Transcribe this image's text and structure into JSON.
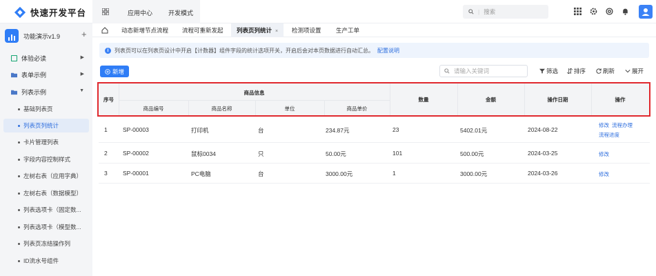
{
  "header": {
    "logo_text": "快速开发平台",
    "menus": [
      "应用中心",
      "开发模式"
    ],
    "search_placeholder": "搜索"
  },
  "sidebar": {
    "app_name": "功能演示v1.9",
    "groups": [
      {
        "label": "体验必读"
      },
      {
        "label": "表单示例"
      },
      {
        "label": "列表示例"
      }
    ],
    "sub_items": [
      {
        "label": "基础列表页"
      },
      {
        "label": "列表页列统计"
      },
      {
        "label": "卡片管理列表"
      },
      {
        "label": "字段内容控制样式"
      },
      {
        "label": "左树右表（应用字典）"
      },
      {
        "label": "左树右表（数据模型）"
      },
      {
        "label": "列表选项卡（固定数..."
      },
      {
        "label": "列表选项卡（模型数..."
      },
      {
        "label": "列表页冻结操作列"
      },
      {
        "label": "ID流水号组件"
      }
    ]
  },
  "tabs": [
    {
      "label": "动态新增节点流程"
    },
    {
      "label": "流程可重新发起"
    },
    {
      "label": "列表页列统计",
      "close": "×"
    },
    {
      "label": "检测项设置"
    },
    {
      "label": "生产工单"
    }
  ],
  "notice": {
    "text": "列表页可以在列表页设计中开启【计数器】组件字段的统计选项开关，开启后会对本页数据进行自动汇总。",
    "link": "配置说明"
  },
  "toolbar": {
    "add": "新增",
    "keyword_placeholder": "请输入关键词",
    "filter": "筛选",
    "sort": "排序",
    "refresh": "刷新",
    "expand": "展开"
  },
  "table": {
    "headers": {
      "seq": "序号",
      "group": "商品信息",
      "code": "商品编号",
      "name": "商品名称",
      "unit": "单位",
      "price": "商品单价",
      "qty": "数量",
      "amount": "金额",
      "date": "操作日期",
      "ops": "操作"
    },
    "rows": [
      {
        "seq": "1",
        "code": "SP-00003",
        "name": "打印机",
        "unit": "台",
        "price": "234.87元",
        "qty": "23",
        "amount": "5402.01元",
        "date": "2024-08-22",
        "ops": [
          "修改",
          "流程办理",
          "流程进度"
        ]
      },
      {
        "seq": "2",
        "code": "SP-00002",
        "name": "鼠标0034",
        "unit": "只",
        "price": "50.00元",
        "qty": "101",
        "amount": "500.00元",
        "date": "2024-03-25",
        "ops": [
          "修改"
        ]
      },
      {
        "seq": "3",
        "code": "SP-00001",
        "name": "PC电脑",
        "unit": "台",
        "price": "3000.00元",
        "qty": "1",
        "amount": "3000.00元",
        "date": "2024-03-26",
        "ops": [
          "修改"
        ]
      }
    ]
  },
  "colors": {
    "accent": "#2f7df6",
    "highlight_border": "#e0282d"
  }
}
